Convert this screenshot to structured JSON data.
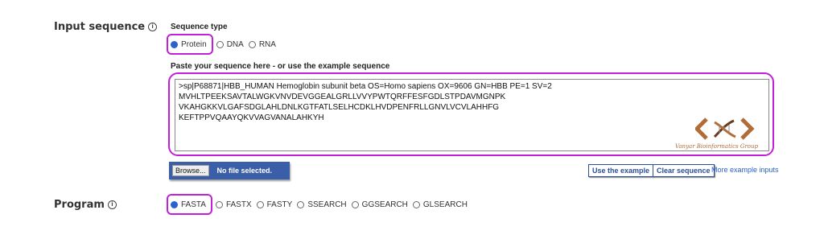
{
  "input_sequence": {
    "label": "Input sequence",
    "info_glyph": "ⓘ",
    "sequence_type": {
      "title": "Sequence type",
      "options": [
        "Protein",
        "DNA",
        "RNA"
      ],
      "selected": "Protein"
    },
    "paste_title": "Paste your sequence here - or use the example sequence",
    "sequence_text": ">sp|P68871|HBB_HUMAN Hemoglobin subunit beta OS=Homo sapiens OX=9606 GN=HBB PE=1 SV=2\nMVHLTPEEKSAVTALWGKVNVDEVGGEALGRLLVVYPWTQRFFESFGDLSTPDAVMGNPK\nVKAHGKKVLGAFSDGLAHLDNLKGTFATLSELHCDKLHVDPENFRLLGNVLVCVLAHHFG\nKEFTPPVQAAYQKVVAGVANALAHKYH",
    "logo_text": "Vanyar Bioinformatics Group",
    "browse_label": "Browse...",
    "no_file_label": "No file selected.",
    "use_example_label": "Use the example",
    "clear_label": "Clear sequence",
    "more_examples_label": "More example inputs"
  },
  "program": {
    "label": "Program",
    "info_glyph": "ⓘ",
    "options": [
      "FASTA",
      "FASTX",
      "FASTY",
      "SSEARCH",
      "GGSEARCH",
      "GLSEARCH"
    ],
    "selected": "FASTA"
  },
  "colors": {
    "highlight": "#c11fd8",
    "radio_selected": "#2a63c9",
    "browse_bar": "#3a5ea8"
  }
}
